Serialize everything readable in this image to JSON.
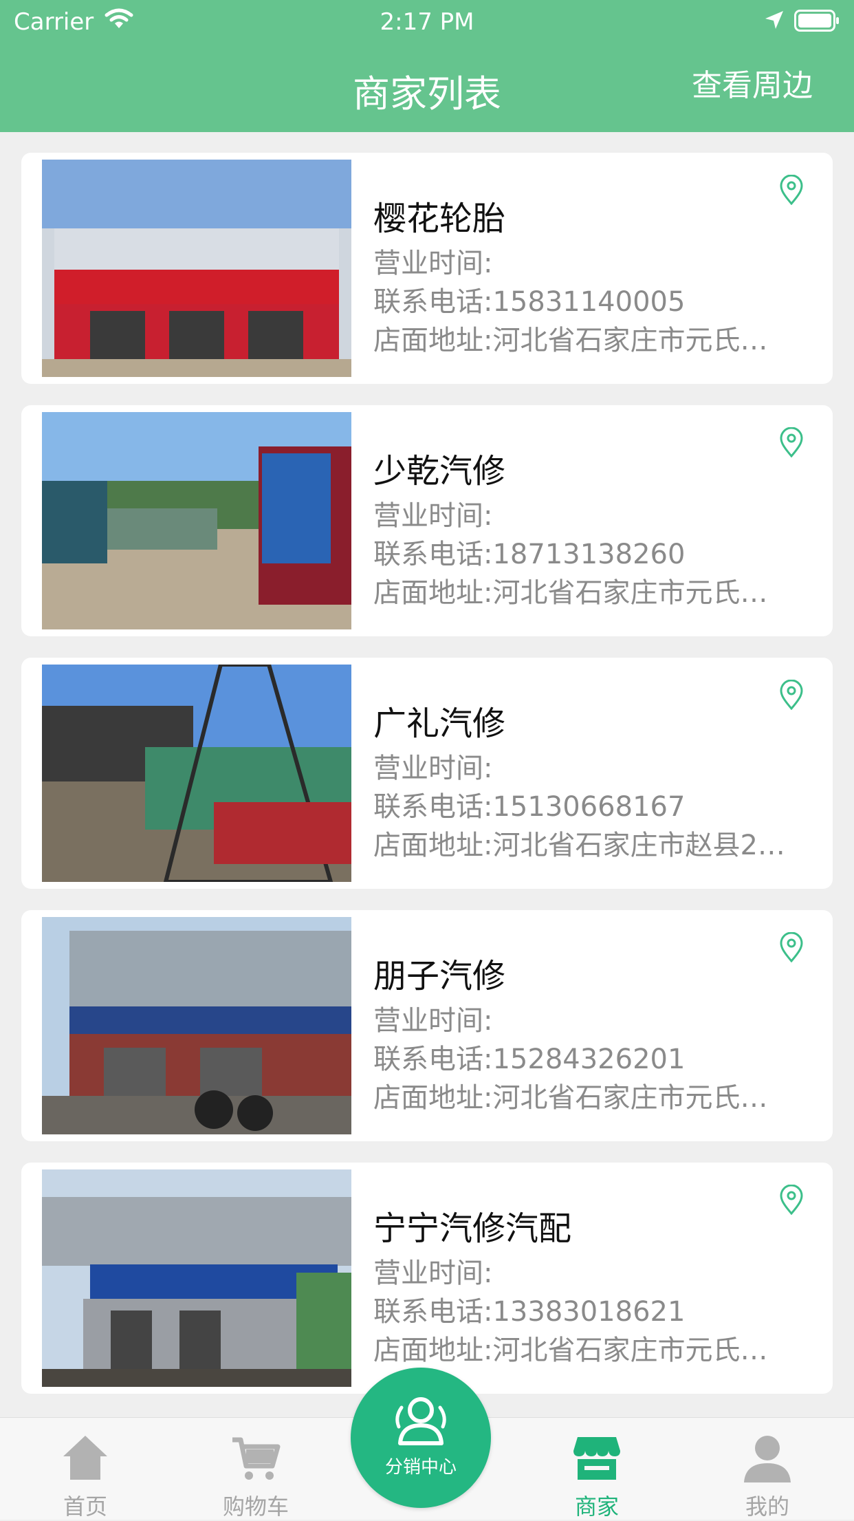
{
  "status_bar": {
    "carrier": "Carrier",
    "time": "2:17 PM"
  },
  "nav": {
    "title": "商家列表",
    "right_action": "查看周边"
  },
  "merchants": [
    {
      "name": "樱花轮胎",
      "hours": "营业时间:",
      "phone": "联系电话:15831140005",
      "address": "店面地址:河北省石家庄市元氏…"
    },
    {
      "name": "少乾汽修",
      "hours": "营业时间:",
      "phone": "联系电话:18713138260",
      "address": "店面地址:河北省石家庄市元氏…"
    },
    {
      "name": "广礼汽修",
      "hours": "营业时间:",
      "phone": "联系电话:15130668167",
      "address": "店面地址:河北省石家庄市赵县2…"
    },
    {
      "name": "朋子汽修",
      "hours": "营业时间:",
      "phone": "联系电话:15284326201",
      "address": "店面地址:河北省石家庄市元氏…"
    },
    {
      "name": "宁宁汽修汽配",
      "hours": "营业时间:",
      "phone": "联系电话:13383018621",
      "address": "店面地址:河北省石家庄市元氏…"
    }
  ],
  "tabs": [
    {
      "label": "首页",
      "icon": "home-icon"
    },
    {
      "label": "购物车",
      "icon": "cart-icon"
    },
    {
      "label": "商家",
      "icon": "store-icon",
      "active": true
    },
    {
      "label": "我的",
      "icon": "user-icon"
    }
  ],
  "fab": {
    "label": "分销中心",
    "icon": "users-icon"
  },
  "colors": {
    "primary": "#65c48e",
    "accent": "#1fb37a",
    "muted_text": "#8a8a8a"
  }
}
